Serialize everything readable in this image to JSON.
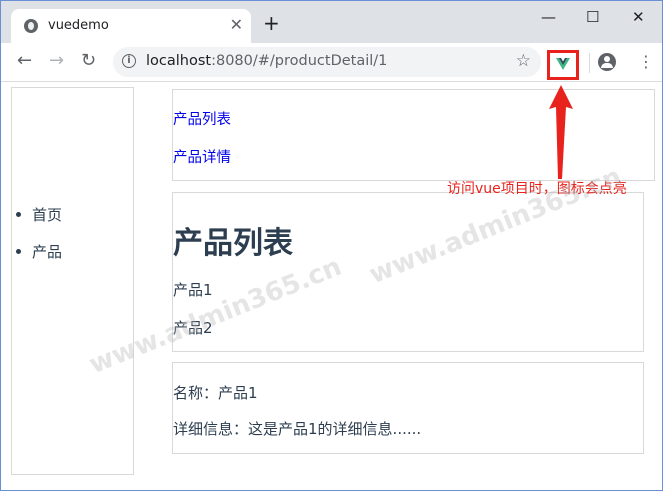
{
  "browser": {
    "tab_title": "vuedemo",
    "tab_close": "✕",
    "new_tab": "+",
    "window_minimize": "—",
    "window_maximize": "☐",
    "window_close": "✕",
    "nav_back": "←",
    "nav_forward": "→",
    "nav_reload": "↻",
    "url_host": "localhost",
    "url_path": ":8080/#/productDetail/1",
    "bookmark_star": "☆",
    "menu_dots": "⋮",
    "extension_icon": "vue-devtools-icon"
  },
  "sidebar": {
    "items": [
      {
        "label": "首页"
      },
      {
        "label": "产品"
      }
    ]
  },
  "top_links": [
    {
      "label": "产品列表"
    },
    {
      "label": "产品详情"
    }
  ],
  "product_list": {
    "heading": "产品列表",
    "items": [
      "产品1",
      "产品2"
    ]
  },
  "product_detail": {
    "name_line": "名称：产品1",
    "detail_line": "详细信息：这是产品1的详细信息......"
  },
  "annotation": {
    "text": "访问vue项目时，图标会点亮",
    "color": "#e8231d"
  },
  "watermark": "www.admin365.cn",
  "colors": {
    "vue_green": "#41b883",
    "vue_dark": "#35495e",
    "text": "#2c3e50",
    "link": "#0000ee"
  }
}
